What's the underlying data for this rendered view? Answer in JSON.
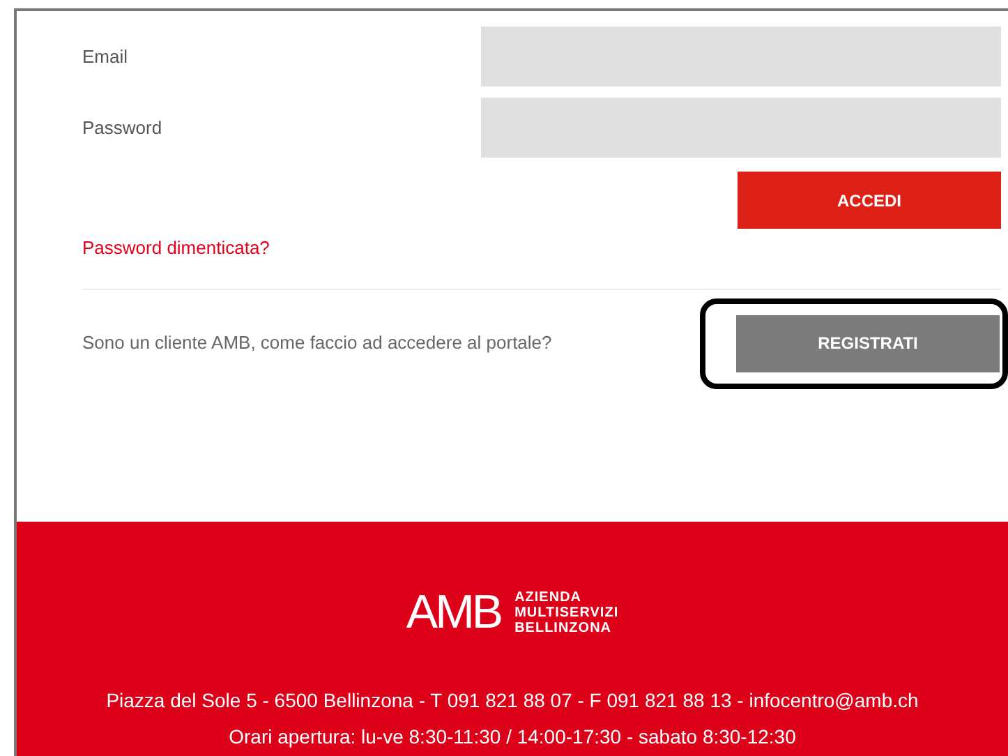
{
  "form": {
    "fields": [
      {
        "label": "Email"
      },
      {
        "label": "Password"
      }
    ],
    "login_button": "ACCEDI",
    "forgot_link": "Password dimenticata?"
  },
  "register": {
    "question": "Sono un cliente AMB, come faccio ad accedere al portale?",
    "button": "REGISTRATI",
    "highlighted": true
  },
  "footer": {
    "logo": {
      "mark": "AMB",
      "lines": [
        "AZIENDA",
        "MULTISERVIZI",
        "BELLINZONA"
      ]
    },
    "address": "Piazza del Sole 5 - 6500 Bellinzona - T 091 821 88 07 - F 091 821 88 13 - infocentro@amb.ch",
    "hours": "Orari apertura: lu-ve 8:30-11:30 / 14:00-17:30 - sabato 8:30-12:30"
  }
}
